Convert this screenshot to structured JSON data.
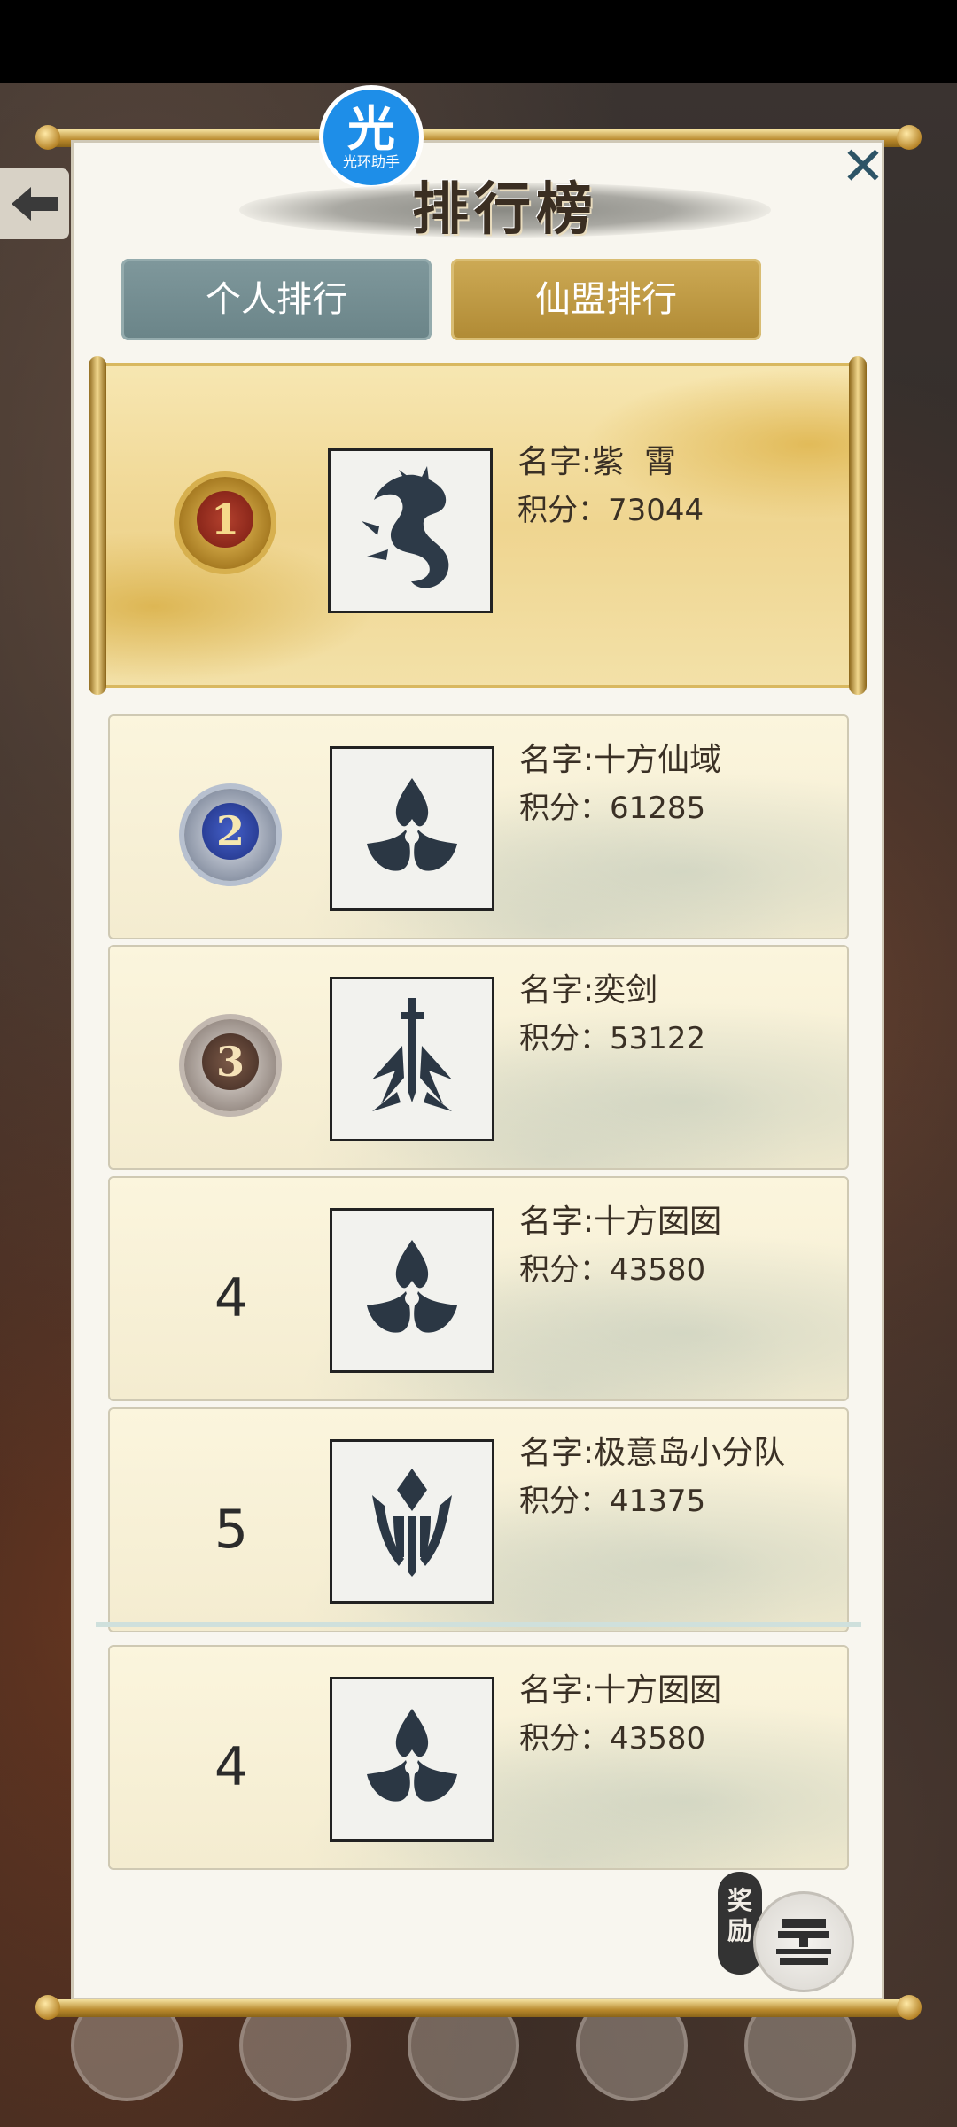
{
  "brand": {
    "logo_char": "光",
    "logo_text": "光环助手"
  },
  "header": {
    "title": "排行榜",
    "close_symbol": "✕"
  },
  "tabs": [
    {
      "label": "个人排行",
      "active": false
    },
    {
      "label": "仙盟排行",
      "active": true
    }
  ],
  "rows": [
    {
      "rank": "1",
      "name": "名字:紫  霄",
      "score": "积分：73044",
      "emblem": "dragon-icon"
    },
    {
      "rank": "2",
      "name": "名字:十方仙域",
      "score": "积分：61285",
      "emblem": "trefoil-icon"
    },
    {
      "rank": "3",
      "name": "名字:奕剑",
      "score": "积分：53122",
      "emblem": "sword-icon"
    },
    {
      "rank": "4",
      "name": "名字:十方囡囡",
      "score": "积分：43580",
      "emblem": "trefoil-icon"
    },
    {
      "rank": "5",
      "name": "名字:极意岛小分队",
      "score": "积分：41375",
      "emblem": "crown-icon"
    }
  ],
  "my_row": {
    "rank": "4",
    "name": "名字:十方囡囡",
    "score": "积分：43580",
    "emblem": "trefoil-icon"
  },
  "reward": {
    "label": "奖励"
  },
  "colors": {
    "gold": "#b08a34",
    "slate_tab": "#6a8488",
    "rank1": "#8e2a1e",
    "rank2": "#2b46a6",
    "rank3": "#6b4a3a"
  }
}
